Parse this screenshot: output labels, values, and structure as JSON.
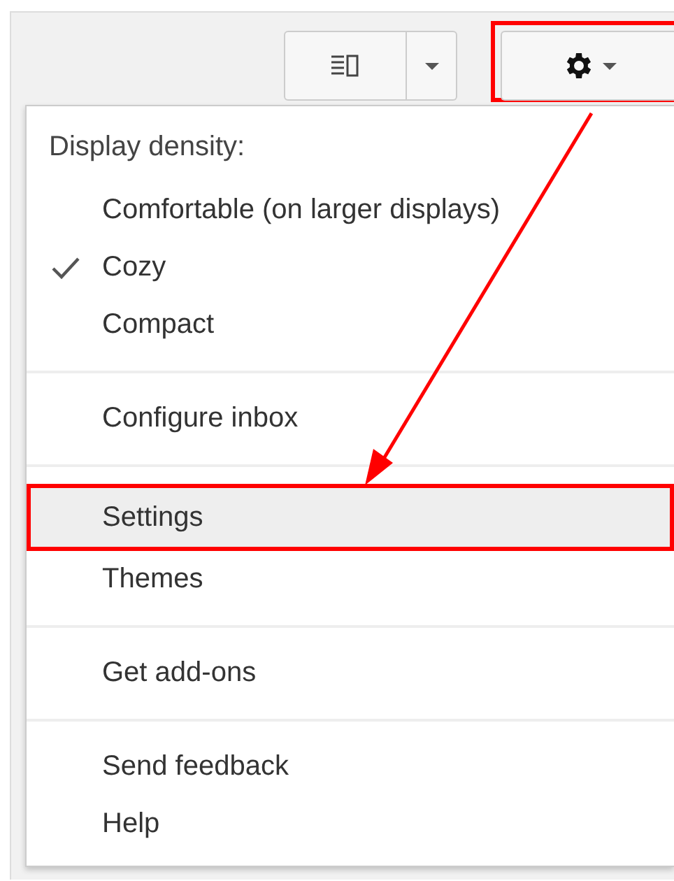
{
  "toolbar": {
    "view_button": {
      "kind": "split"
    },
    "settings_button": {
      "highlighted": true
    }
  },
  "menu": {
    "heading": "Display density:",
    "sections": [
      {
        "items": [
          {
            "label": "Comfortable (on larger displays)",
            "checked": false,
            "selected": false
          },
          {
            "label": "Cozy",
            "checked": true,
            "selected": false
          },
          {
            "label": "Compact",
            "checked": false,
            "selected": false
          }
        ]
      },
      {
        "items": [
          {
            "label": "Configure inbox",
            "checked": false,
            "selected": false
          }
        ]
      },
      {
        "items": [
          {
            "label": "Settings",
            "checked": false,
            "selected": true
          },
          {
            "label": "Themes",
            "checked": false,
            "selected": false
          }
        ]
      },
      {
        "items": [
          {
            "label": "Get add-ons",
            "checked": false,
            "selected": false
          }
        ]
      },
      {
        "items": [
          {
            "label": "Send feedback",
            "checked": false,
            "selected": false
          },
          {
            "label": "Help",
            "checked": false,
            "selected": false
          }
        ]
      }
    ]
  }
}
